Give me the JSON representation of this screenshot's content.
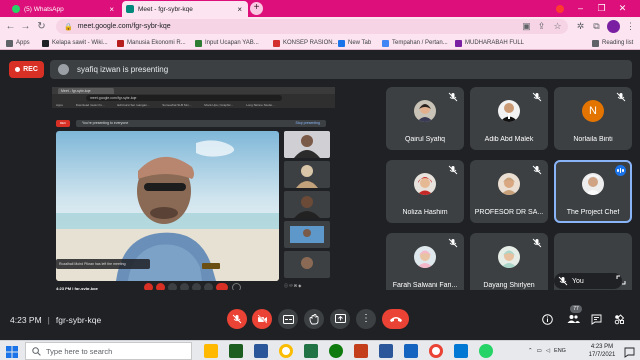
{
  "browser": {
    "tabs": [
      {
        "title": "(5) WhatsApp",
        "active": false,
        "favicon_color": "#25d366"
      },
      {
        "title": "Meet - fgr-sybr-kqe",
        "active": true,
        "favicon_color": "#00897b"
      }
    ],
    "url": "meet.google.com/fgr-sybr-kqe",
    "bookmarks": [
      {
        "label": "Apps",
        "icon_color": "#5f6368"
      },
      {
        "label": "Kelapa sawit - Wiki...",
        "icon_color": "#202124"
      },
      {
        "label": "Manusia Ekonomi R...",
        "icon_color": "#b71c1c"
      },
      {
        "label": "Input Ucapan YAB...",
        "icon_color": "#2e7d32"
      },
      {
        "label": "KONSEP RASION...",
        "icon_color": "#d32f2f"
      },
      {
        "label": "New Tab",
        "icon_color": "#1a73e8"
      },
      {
        "label": "Tempahan / Pertan...",
        "icon_color": "#4285f4"
      },
      {
        "label": "MUDHARABAH FULL",
        "icon_color": "#7b1fa2"
      }
    ],
    "reading_list": "Reading list"
  },
  "meet": {
    "rec_label": "REC",
    "presenting_text": "syafiq izwan is presenting",
    "participants": [
      {
        "name": "Qairul Syafiq",
        "type": "photo"
      },
      {
        "name": "Adib Abd Malek",
        "type": "photo"
      },
      {
        "name": "Norlaila Binti",
        "type": "initial",
        "initial": "N"
      },
      {
        "name": "Noliza Hashim",
        "type": "photo"
      },
      {
        "name": "PROFESOR DR SA...",
        "type": "photo"
      },
      {
        "name": "The Project Chef",
        "type": "photo",
        "speaking": true
      },
      {
        "name": "Farah Salwani Fari...",
        "type": "photo"
      },
      {
        "name": "Dayang Shirlyen",
        "type": "photo"
      }
    ],
    "self_tile_label": "You",
    "time": "4:23 PM",
    "meeting_code": "fgr-sybr-kqe",
    "people_count": "77"
  },
  "shared_screen": {
    "tab_title": "Meet - fgr-sybr-kqe",
    "url": "meet.google.com/fgr-sybr-kqe",
    "bookmarks": [
      "Apps",
      "Download music fro...",
      "Edit kursi Set ruangan...",
      "Somewhat SLB Sim...",
      "Mock-Ups | Graphic...",
      "Long Skinne Studio..."
    ],
    "rec_label": "REC",
    "presenting_text": "You're presenting to everyone",
    "stop_label": "Stop presenting",
    "caption": "Rozalhail Mohd Pikran has left the meeting",
    "time_code": "4:23 PM | fgr-sybr-kqe"
  },
  "taskbar": {
    "search_placeholder": "Type here to search",
    "language": "ENG",
    "clock_time": "4:23 PM",
    "clock_date": "17/7/2021"
  },
  "colors": {
    "tabstrip": "#dd0f7a",
    "meet_bg": "#202124",
    "tile_bg": "#3c4043",
    "danger": "#ea4335",
    "accent": "#8ab4f8"
  }
}
